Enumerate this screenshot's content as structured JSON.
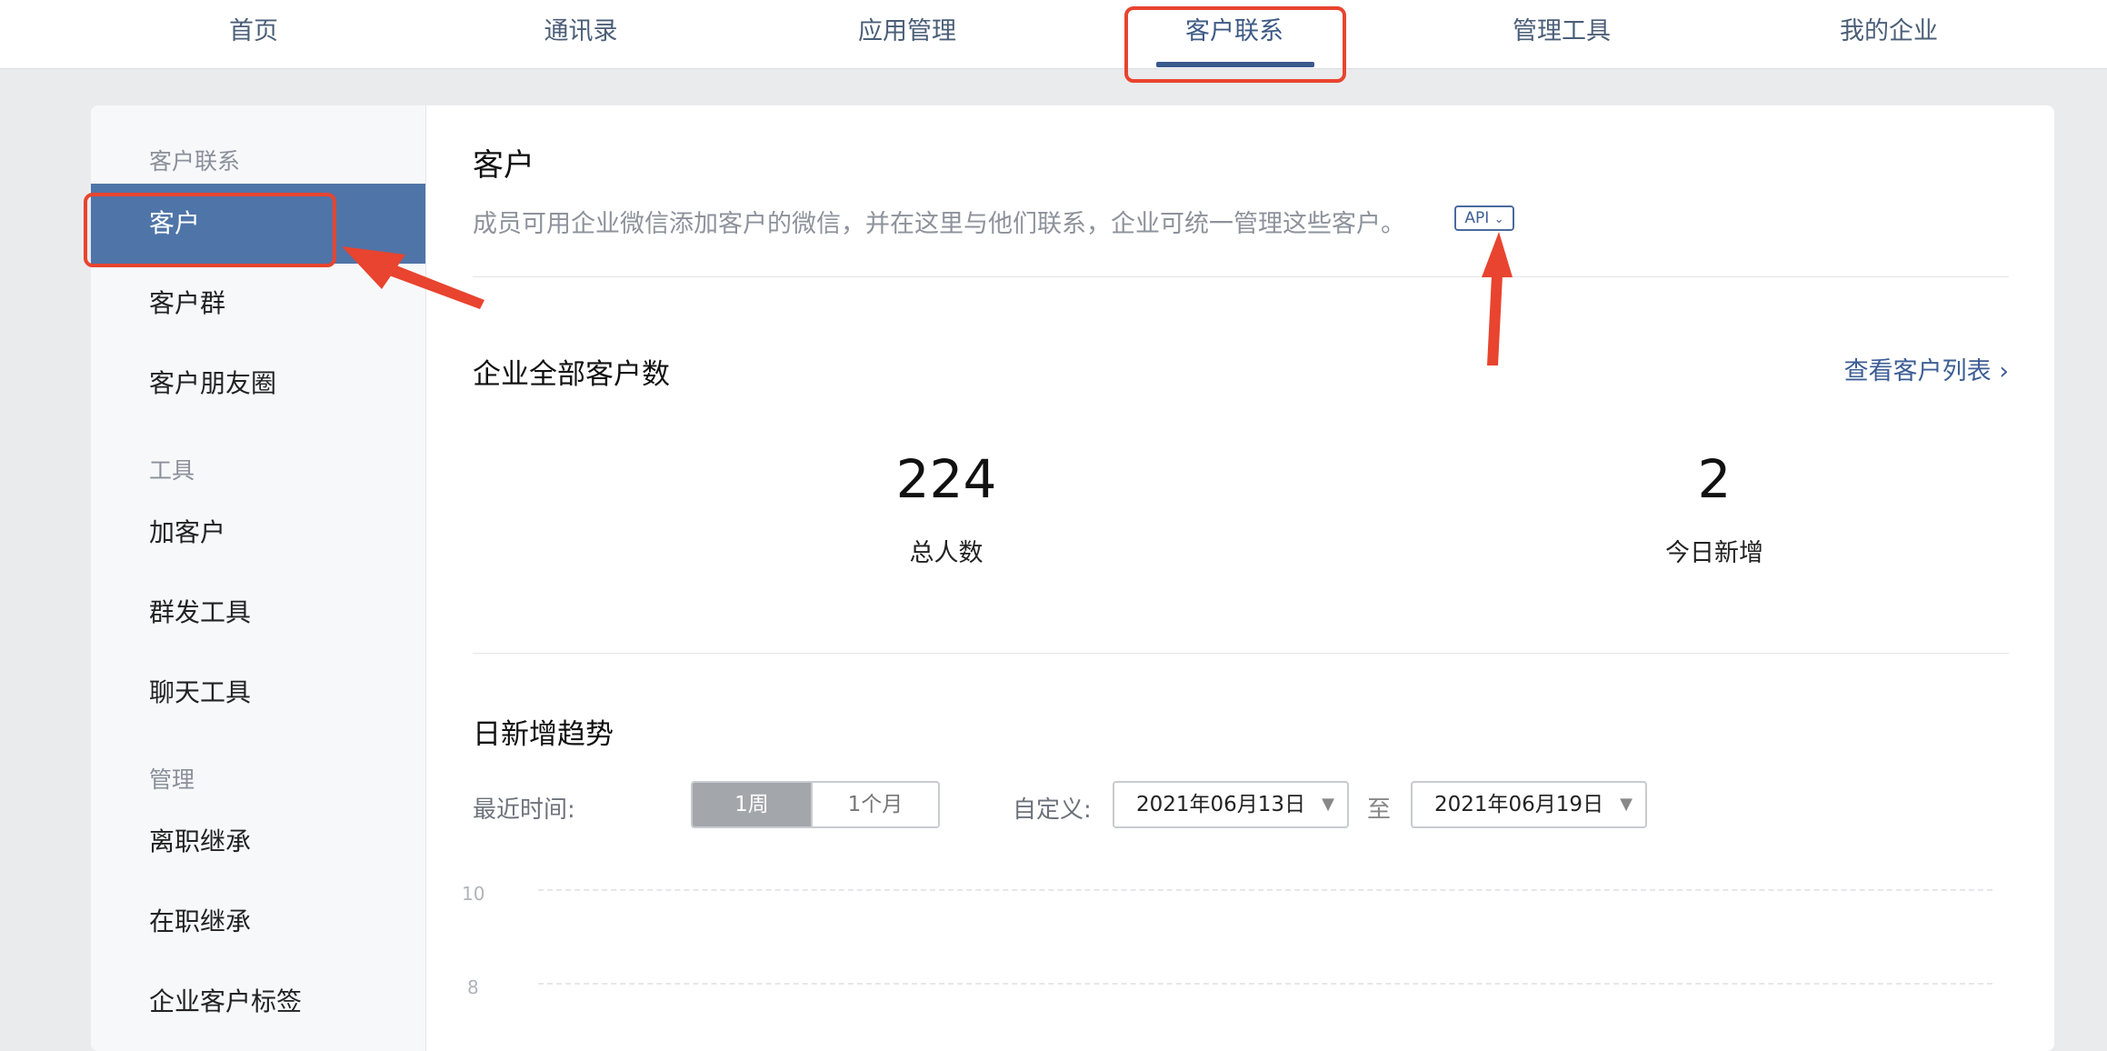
{
  "nav": {
    "items": [
      "首页",
      "通讯录",
      "应用管理",
      "客户联系",
      "管理工具",
      "我的企业"
    ],
    "active_index": 3
  },
  "sidebar": {
    "groups": [
      {
        "label": "客户联系",
        "items": [
          "客户",
          "客户群",
          "客户朋友圈"
        ]
      },
      {
        "label": "工具",
        "items": [
          "加客户",
          "群发工具",
          "聊天工具"
        ]
      },
      {
        "label": "管理",
        "items": [
          "离职继承",
          "在职继承",
          "企业客户标签"
        ]
      }
    ],
    "active_item": "客户"
  },
  "main": {
    "title": "客户",
    "description": "成员可用企业微信添加客户的微信，并在这里与他们联系，企业可统一管理这些客户。",
    "api_badge": "API",
    "total_section": {
      "title": "企业全部客户数",
      "link": "查看客户列表",
      "stats": [
        {
          "value": "224",
          "label": "总人数"
        },
        {
          "value": "2",
          "label": "今日新增"
        }
      ]
    },
    "trend_section": {
      "title": "日新增趋势",
      "recent_label": "最近时间:",
      "ranges": [
        "1周",
        "1个月"
      ],
      "active_range": "1周",
      "custom_label": "自定义:",
      "start_date": "2021年06月13日",
      "to_label": "至",
      "end_date": "2021年06月19日",
      "y_ticks": [
        "10",
        "8"
      ]
    }
  },
  "colors": {
    "accent": "#4f74a8",
    "highlight": "#e8442f",
    "link": "#3d5d94"
  }
}
